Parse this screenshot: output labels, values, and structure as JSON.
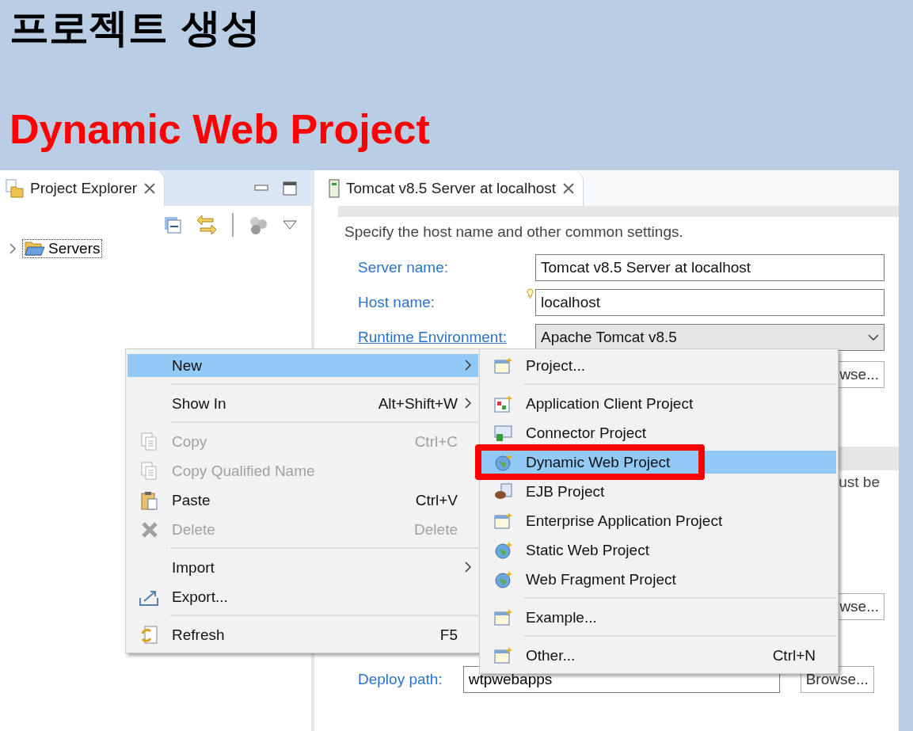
{
  "slide": {
    "title": "프로젝트 생성",
    "subtitle": "Dynamic Web Project"
  },
  "project_explorer": {
    "tab": "Project Explorer",
    "tree": [
      {
        "label": "Servers",
        "expanded": false
      }
    ]
  },
  "editor": {
    "tab": "Tomcat v8.5 Server at localhost",
    "description": "Specify the host name and other common settings.",
    "fields": [
      {
        "label": "Server name:",
        "value": "Tomcat v8.5 Server at localhost",
        "kind": "text",
        "link": false,
        "hint": false
      },
      {
        "label": "Host name:",
        "value": "localhost",
        "kind": "text",
        "link": false,
        "hint": true
      },
      {
        "label": "Runtime Environment:",
        "value": "Apache Tomcat v8.5",
        "kind": "dropdown",
        "link": true,
        "hint": false
      }
    ],
    "browse_fragment_1": "wse...",
    "note_fragment": "ust be",
    "browse_fragment_2": "wse...",
    "deploy": {
      "label": "Deploy path:",
      "value": "wtpwebapps",
      "button": "Browse..."
    }
  },
  "context_menu": {
    "items": [
      {
        "kind": "item",
        "label": "New",
        "submenu": true,
        "disabled": false,
        "selected": true
      },
      {
        "kind": "separator"
      },
      {
        "kind": "item",
        "label": "Show In",
        "shortcut": "Alt+Shift+W",
        "submenu": true,
        "disabled": false,
        "selected": false
      },
      {
        "kind": "separator"
      },
      {
        "kind": "item",
        "label": "Copy",
        "shortcut": "Ctrl+C",
        "submenu": false,
        "disabled": true,
        "selected": false
      },
      {
        "kind": "item",
        "label": "Copy Qualified Name",
        "submenu": false,
        "disabled": true,
        "selected": false
      },
      {
        "kind": "item",
        "label": "Paste",
        "shortcut": "Ctrl+V",
        "submenu": false,
        "disabled": false,
        "selected": false
      },
      {
        "kind": "item",
        "label": "Delete",
        "shortcut": "Delete",
        "submenu": false,
        "disabled": true,
        "selected": false
      },
      {
        "kind": "separator"
      },
      {
        "kind": "item",
        "label": "Import",
        "submenu": true,
        "disabled": false,
        "selected": false
      },
      {
        "kind": "item",
        "label": "Export...",
        "submenu": false,
        "disabled": false,
        "selected": false
      },
      {
        "kind": "separator"
      },
      {
        "kind": "item",
        "label": "Refresh",
        "shortcut": "F5",
        "submenu": false,
        "disabled": false,
        "selected": false
      }
    ]
  },
  "submenu": {
    "items": [
      {
        "kind": "item",
        "label": "Project...",
        "selected": false
      },
      {
        "kind": "separator"
      },
      {
        "kind": "item",
        "label": "Application Client Project",
        "selected": false
      },
      {
        "kind": "item",
        "label": "Connector Project",
        "selected": false
      },
      {
        "kind": "item",
        "label": "Dynamic Web Project",
        "selected": true
      },
      {
        "kind": "item",
        "label": "EJB Project",
        "selected": false
      },
      {
        "kind": "item",
        "label": "Enterprise Application Project",
        "selected": false
      },
      {
        "kind": "item",
        "label": "Static Web Project",
        "selected": false
      },
      {
        "kind": "item",
        "label": "Web Fragment Project",
        "selected": false
      },
      {
        "kind": "separator"
      },
      {
        "kind": "item",
        "label": "Example...",
        "selected": false
      },
      {
        "kind": "separator"
      },
      {
        "kind": "item",
        "label": "Other...",
        "shortcut": "Ctrl+N",
        "selected": false
      }
    ]
  }
}
